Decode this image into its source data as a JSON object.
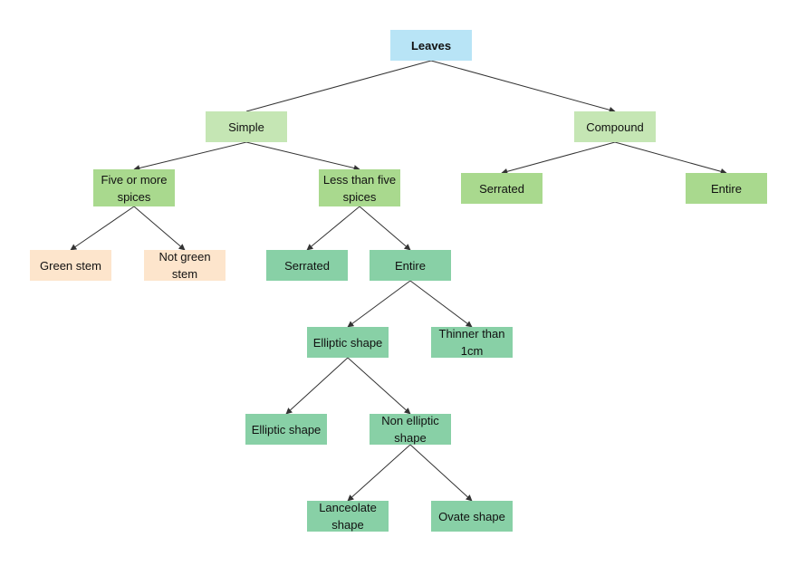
{
  "colors": {
    "root": "#b8e4f6",
    "level1": "#c5e6b4",
    "level2": "#a9d98e",
    "stem": "#fde5cc",
    "leaf": "#88d0a6",
    "edge": "#333333"
  },
  "nodes": [
    {
      "id": "leaves",
      "label": "Leaves",
      "color": "root",
      "parent": null
    },
    {
      "id": "simple",
      "label": "Simple",
      "color": "level1",
      "parent": "leaves"
    },
    {
      "id": "compound",
      "label": "Compound",
      "color": "level1",
      "parent": "leaves"
    },
    {
      "id": "five-or-more",
      "label": "Five or more spices",
      "color": "level2",
      "parent": "simple"
    },
    {
      "id": "less-than-five",
      "label": "Less than five spices",
      "color": "level2",
      "parent": "simple"
    },
    {
      "id": "compound-serrated",
      "label": "Serrated",
      "color": "level2",
      "parent": "compound"
    },
    {
      "id": "compound-entire",
      "label": "Entire",
      "color": "level2",
      "parent": "compound"
    },
    {
      "id": "green-stem",
      "label": "Green stem",
      "color": "stem",
      "parent": "five-or-more"
    },
    {
      "id": "not-green-stem",
      "label": "Not green stem",
      "color": "stem",
      "parent": "five-or-more"
    },
    {
      "id": "simple-serrated",
      "label": "Serrated",
      "color": "leaf",
      "parent": "less-than-five"
    },
    {
      "id": "simple-entire",
      "label": "Entire",
      "color": "leaf",
      "parent": "less-than-five"
    },
    {
      "id": "elliptic-shape",
      "label": "Elliptic shape",
      "color": "leaf",
      "parent": "simple-entire"
    },
    {
      "id": "thinner-than-1cm",
      "label": "Thinner than 1cm",
      "color": "leaf",
      "parent": "simple-entire"
    },
    {
      "id": "elliptic-shape-2",
      "label": "Elliptic shape",
      "color": "leaf",
      "parent": "elliptic-shape"
    },
    {
      "id": "non-elliptic-shape",
      "label": "Non elliptic shape",
      "color": "leaf",
      "parent": "elliptic-shape"
    },
    {
      "id": "lanceolate-shape",
      "label": "Lanceolate shape",
      "color": "leaf",
      "parent": "non-elliptic-shape"
    },
    {
      "id": "ovate-shape",
      "label": "Ovate shape",
      "color": "leaf",
      "parent": "non-elliptic-shape"
    }
  ]
}
